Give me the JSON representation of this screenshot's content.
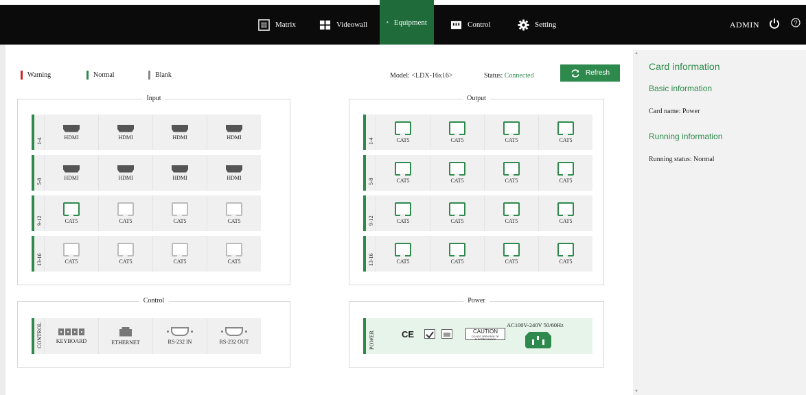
{
  "nav": {
    "items": [
      {
        "label": "Matrix",
        "icon": "matrix-icon"
      },
      {
        "label": "Videowall",
        "icon": "videowall-icon"
      },
      {
        "label": "Equipment",
        "icon": "layers-icon",
        "active": true
      },
      {
        "label": "Control",
        "icon": "control-icon"
      },
      {
        "label": "Setting",
        "icon": "gear-icon"
      }
    ],
    "user": "ADMIN"
  },
  "legend": [
    {
      "label": "Warning",
      "color": "#cc2222"
    },
    {
      "label": "Normal",
      "color": "#2e8a4c"
    },
    {
      "label": "Blank",
      "color": "#888888"
    }
  ],
  "model": {
    "label": "Model:",
    "value": "<LDX-16x16>"
  },
  "status": {
    "label": "Status:",
    "value": "Connected"
  },
  "refresh_label": "Refresh",
  "colors": {
    "accent": "#2e8a4c",
    "topbar": "#0b0b0b"
  },
  "input": {
    "title": "Input",
    "rows": [
      {
        "label": "1-4",
        "ports": [
          {
            "type": "HDMI",
            "state": "blank"
          },
          {
            "type": "HDMI",
            "state": "blank"
          },
          {
            "type": "HDMI",
            "state": "blank"
          },
          {
            "type": "HDMI",
            "state": "blank"
          }
        ]
      },
      {
        "label": "5-8",
        "ports": [
          {
            "type": "HDMI",
            "state": "blank"
          },
          {
            "type": "HDMI",
            "state": "blank"
          },
          {
            "type": "HDMI",
            "state": "blank"
          },
          {
            "type": "HDMI",
            "state": "blank"
          }
        ]
      },
      {
        "label": "9-12",
        "ports": [
          {
            "type": "CAT5",
            "state": "normal"
          },
          {
            "type": "CAT5",
            "state": "blank"
          },
          {
            "type": "CAT5",
            "state": "blank"
          },
          {
            "type": "CAT5",
            "state": "blank"
          }
        ]
      },
      {
        "label": "13-16",
        "ports": [
          {
            "type": "CAT5",
            "state": "blank"
          },
          {
            "type": "CAT5",
            "state": "blank"
          },
          {
            "type": "CAT5",
            "state": "blank"
          },
          {
            "type": "CAT5",
            "state": "blank"
          }
        ]
      }
    ]
  },
  "output": {
    "title": "Output",
    "rows": [
      {
        "label": "1-4",
        "ports": [
          {
            "type": "CAT5",
            "state": "normal"
          },
          {
            "type": "CAT5",
            "state": "normal"
          },
          {
            "type": "CAT5",
            "state": "normal"
          },
          {
            "type": "CAT5",
            "state": "normal"
          }
        ]
      },
      {
        "label": "5-8",
        "ports": [
          {
            "type": "CAT5",
            "state": "normal"
          },
          {
            "type": "CAT5",
            "state": "normal"
          },
          {
            "type": "CAT5",
            "state": "normal"
          },
          {
            "type": "CAT5",
            "state": "normal"
          }
        ]
      },
      {
        "label": "9-12",
        "ports": [
          {
            "type": "CAT5",
            "state": "normal"
          },
          {
            "type": "CAT5",
            "state": "normal"
          },
          {
            "type": "CAT5",
            "state": "normal"
          },
          {
            "type": "CAT5",
            "state": "normal"
          }
        ]
      },
      {
        "label": "13-16",
        "ports": [
          {
            "type": "CAT5",
            "state": "normal"
          },
          {
            "type": "CAT5",
            "state": "normal"
          },
          {
            "type": "CAT5",
            "state": "normal"
          },
          {
            "type": "CAT5",
            "state": "normal"
          }
        ]
      }
    ]
  },
  "control": {
    "title": "Control",
    "row_label": "CONTROL",
    "items": [
      {
        "label": "KEYBOARD",
        "icon": "keyboard-icon"
      },
      {
        "label": "ETHERNET",
        "icon": "ethernet-icon"
      },
      {
        "label": "RS-232 IN",
        "icon": "rs232-in-icon"
      },
      {
        "label": "RS-232 OUT",
        "icon": "rs232-out-icon"
      }
    ]
  },
  "power": {
    "title": "Power",
    "row_label": "POWER",
    "ce_mark": "CE",
    "caution_title": "CAUTION",
    "caution_text": "DO NOT OPEN RISK OF ELECTRIC SHOCK",
    "voltage": "AC100V-240V 50/60Hz"
  },
  "card_info": {
    "title": "Card information",
    "basic_title": "Basic information",
    "card_name_label": "Card name:",
    "card_name_value": "Power",
    "running_title": "Running information",
    "running_status_label": "Running status:",
    "running_status_value": "Normal"
  }
}
